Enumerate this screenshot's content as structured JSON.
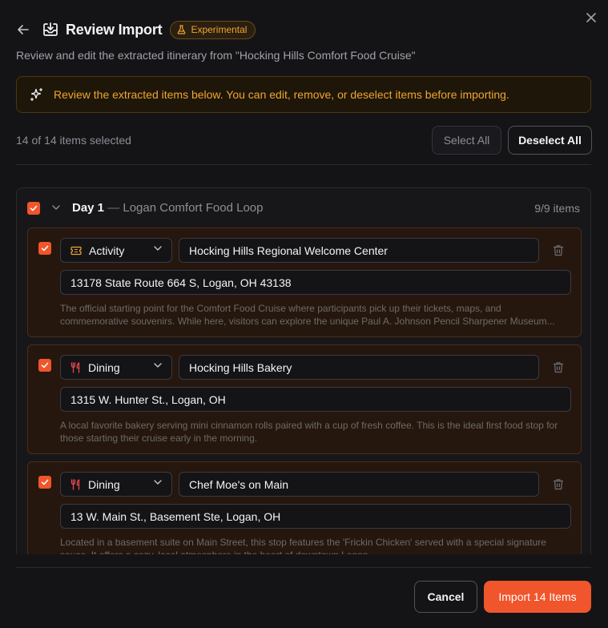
{
  "dialog": {
    "title": "Review Import",
    "badge": "Experimental",
    "subtitle": "Review and edit the extracted itinerary from \"Hocking Hills Comfort Food Cruise\"",
    "notice": "Review the extracted items below. You can edit, remove, or deselect items before importing.",
    "selected_count": "14 of 14 items selected",
    "select_all": "Select All",
    "deselect_all": "Deselect All",
    "cancel": "Cancel",
    "import": "Import 14 Items"
  },
  "day": {
    "label": "Day 1",
    "separator": "—",
    "name": "Logan Comfort Food Loop",
    "count": "9/9 items"
  },
  "items": [
    {
      "type": "Activity",
      "type_icon": "ticket-icon",
      "name": "Hocking Hills Regional Welcome Center",
      "address": "13178 State Route 664 S, Logan, OH 43138",
      "description": "The official starting point for the Comfort Food Cruise where participants pick up their tickets, maps, and commemorative souvenirs. While here, visitors can explore the unique Paul A. Johnson Pencil Sharpener Museum..."
    },
    {
      "type": "Dining",
      "type_icon": "utensils-icon",
      "name": "Hocking Hills Bakery",
      "address": "1315 W. Hunter St., Logan, OH",
      "description": "A local favorite bakery serving mini cinnamon rolls paired with a cup of fresh coffee. This is the ideal first food stop for those starting their cruise early in the morning."
    },
    {
      "type": "Dining",
      "type_icon": "utensils-icon",
      "name": "Chef Moe's on Main",
      "address": "13 W. Main St., Basement Ste, Logan, OH",
      "description": "Located in a basement suite on Main Street, this stop features the 'Frickin Chicken' served with a special signature sauce. It offers a cozy, local atmosphere in the heart of downtown Logan."
    }
  ],
  "colors": {
    "accent": "#f0552b",
    "warning": "#f0a531",
    "dining_icon": "#e5484d"
  }
}
